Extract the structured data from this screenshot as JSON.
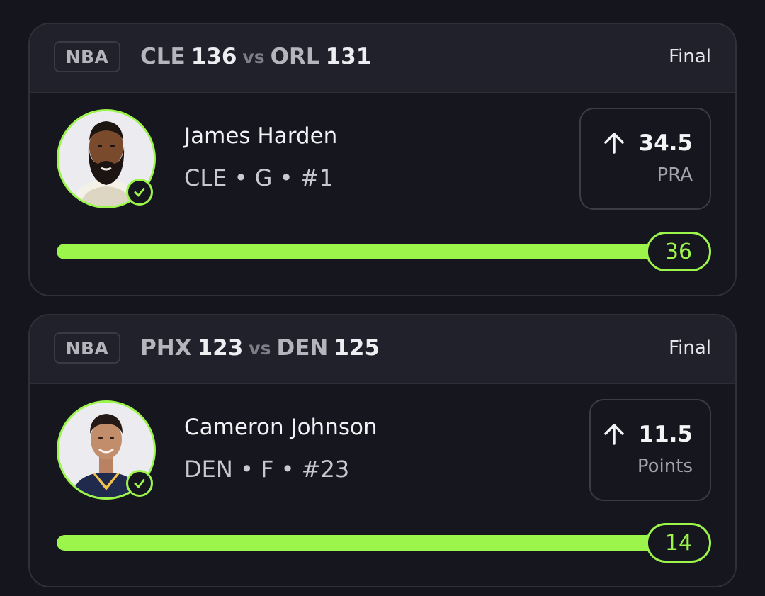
{
  "colors": {
    "accent": "#9cf54a",
    "background": "#14151d",
    "card_header": "#20212a"
  },
  "picks": [
    {
      "league": "NBA",
      "home_team": "CLE",
      "home_score": "136",
      "vs": "vs",
      "away_team": "ORL",
      "away_score": "131",
      "status": "Final",
      "player_name": "James Harden",
      "player_meta": "CLE • G • #1",
      "direction_icon": "arrow-up-icon",
      "line": "34.5",
      "stat": "PRA",
      "result": "36",
      "progress": 1.0,
      "result_icon": "check-circle-icon"
    },
    {
      "league": "NBA",
      "home_team": "PHX",
      "home_score": "123",
      "vs": "vs",
      "away_team": "DEN",
      "away_score": "125",
      "status": "Final",
      "player_name": "Cameron Johnson",
      "player_meta": "DEN • F • #23",
      "direction_icon": "arrow-up-icon",
      "line": "11.5",
      "stat": "Points",
      "result": "14",
      "progress": 1.0,
      "result_icon": "check-circle-icon"
    }
  ]
}
